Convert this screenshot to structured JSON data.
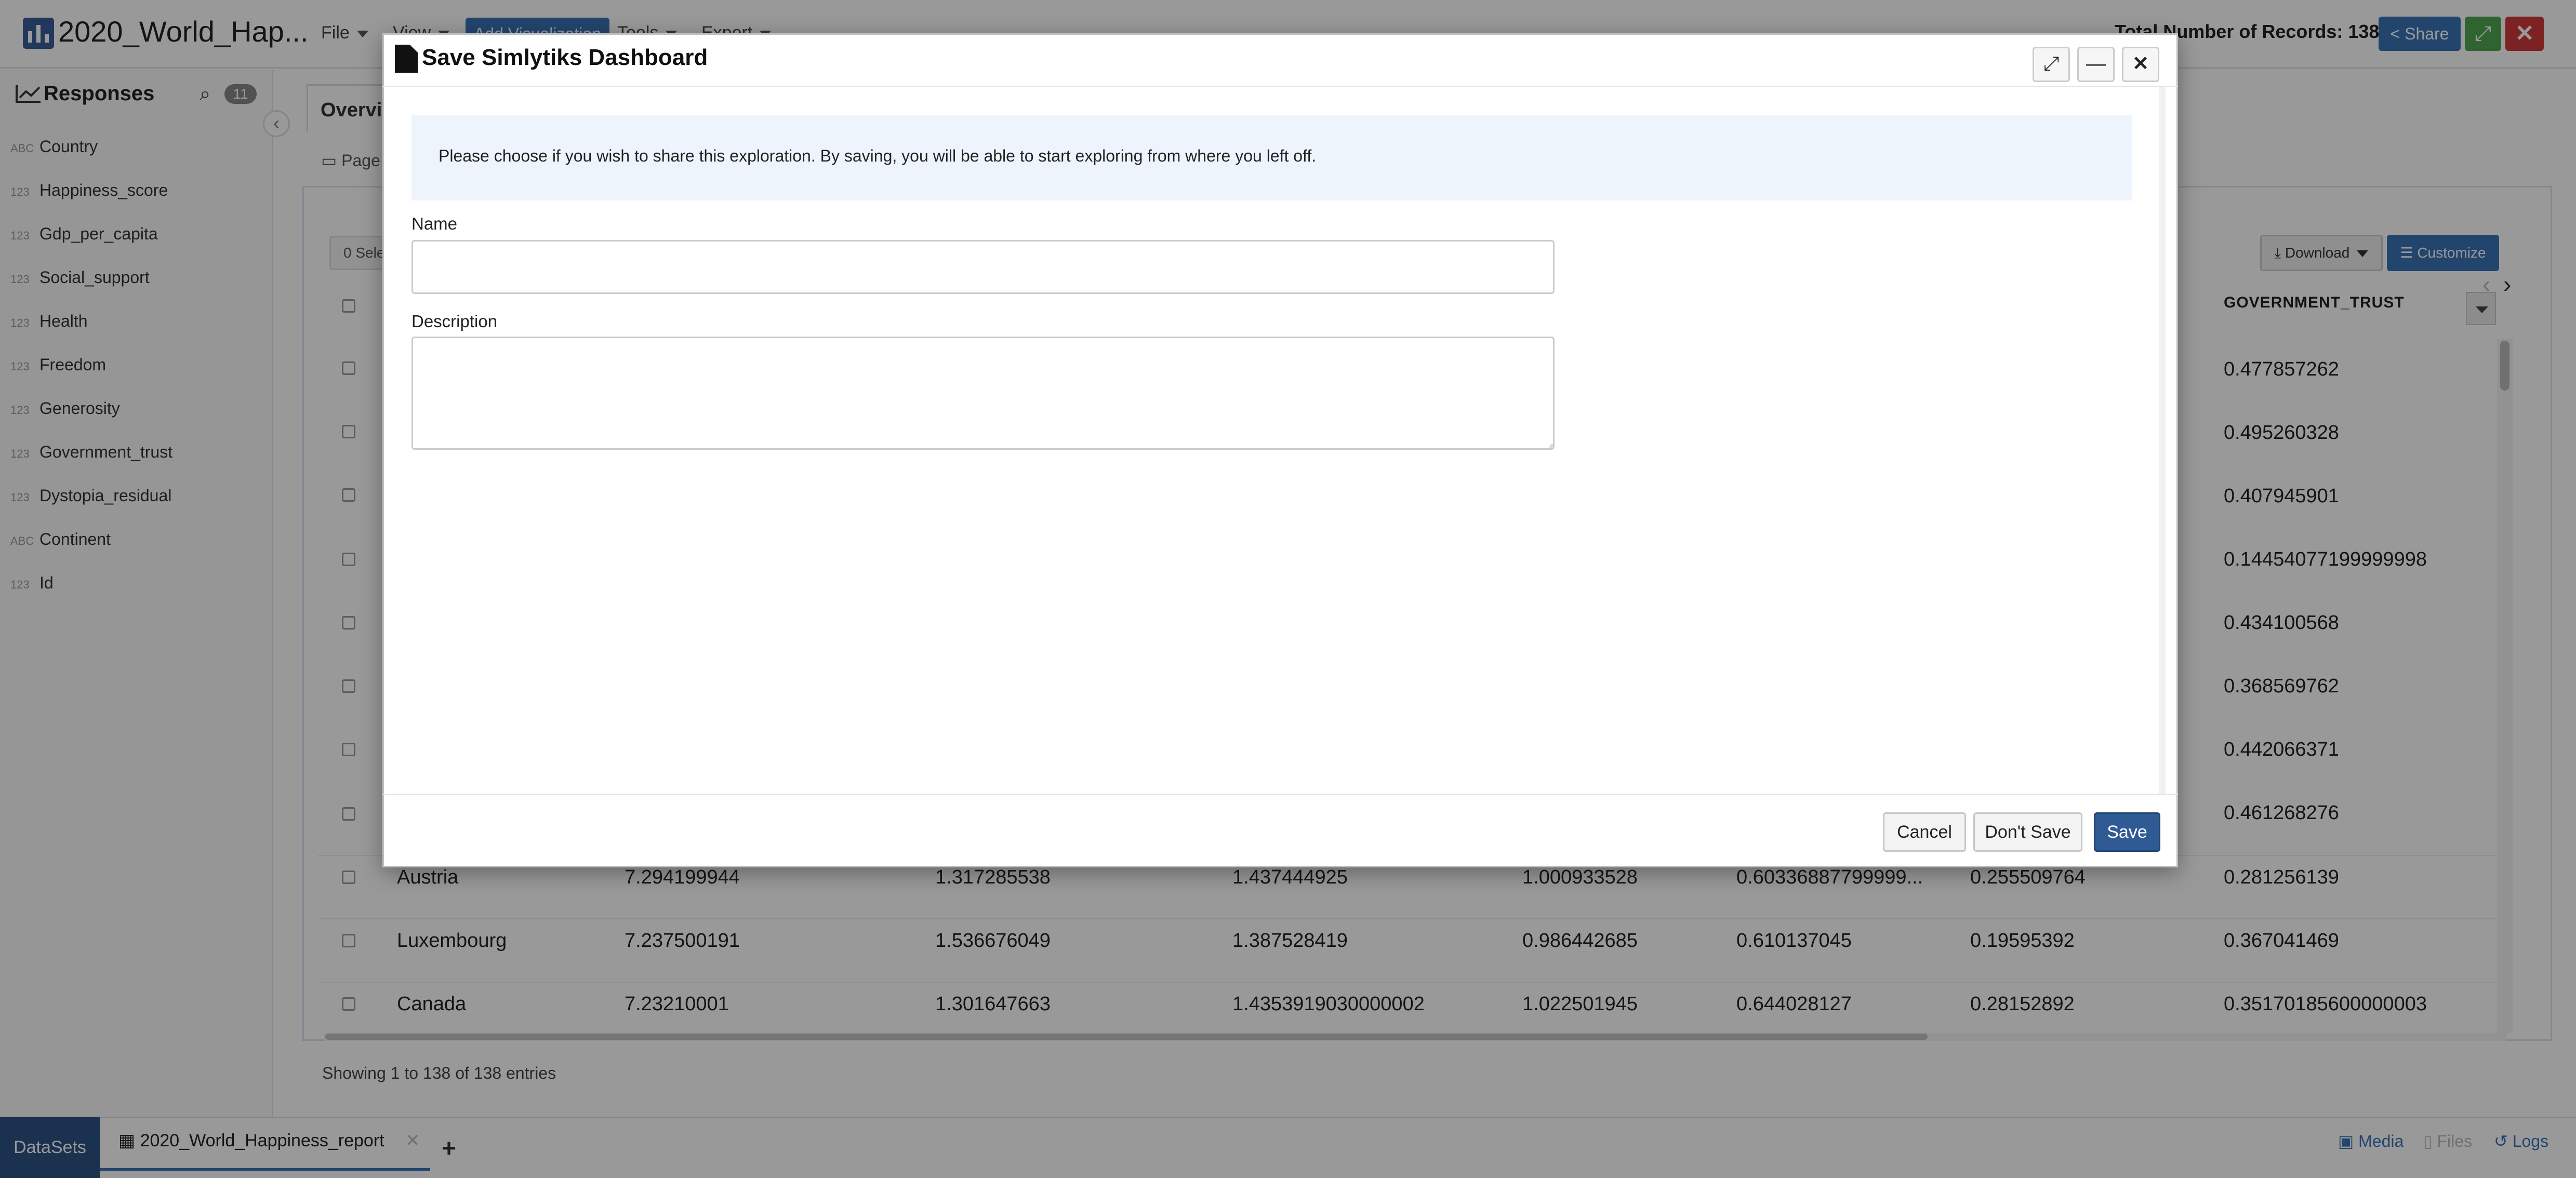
{
  "app": {
    "title": "2020_World_Hap...",
    "menus": [
      "File",
      "View",
      "Add Visualization",
      "Tools",
      "Export"
    ],
    "total_records": "Total Number of Records: 138",
    "share_label": "Share"
  },
  "sidebar": {
    "title": "Responses",
    "badge": "11",
    "fields": [
      {
        "type": "ABC",
        "name": "Country"
      },
      {
        "type": "123",
        "name": "Happiness_score"
      },
      {
        "type": "123",
        "name": "Gdp_per_capita"
      },
      {
        "type": "123",
        "name": "Social_support"
      },
      {
        "type": "123",
        "name": "Health"
      },
      {
        "type": "123",
        "name": "Freedom"
      },
      {
        "type": "123",
        "name": "Generosity"
      },
      {
        "type": "123",
        "name": "Government_trust"
      },
      {
        "type": "123",
        "name": "Dystopia_residual"
      },
      {
        "type": "ABC",
        "name": "Continent"
      },
      {
        "type": "123",
        "name": "Id"
      }
    ]
  },
  "main": {
    "tab_overview": "Overvie",
    "page_tab": "Page",
    "selected": "0 Sele",
    "download_label": "Download",
    "customize_label": "Customize",
    "column_header": "GOVERNMENT_TRUST",
    "gov_trust_column": [
      "0.477857262",
      "0.495260328",
      "0.407945901",
      "0.14454077199999998",
      "0.434100568",
      "0.368569762",
      "0.442066371",
      "0.461268276",
      "0.281256139",
      "0.367041469",
      "0.35170185600000003"
    ],
    "visible_rows": [
      [
        "Austria",
        "7.294199944",
        "1.317285538",
        "1.437444925",
        "1.000933528",
        "0.60336887799999...",
        "0.255509764"
      ],
      [
        "Luxembourg",
        "7.237500191",
        "1.536676049",
        "1.387528419",
        "0.986442685",
        "0.610137045",
        "0.19595392"
      ],
      [
        "Canada",
        "7.23210001",
        "1.301647663",
        "1.4353919030000002",
        "1.022501945",
        "0.644028127",
        "0.28152892"
      ]
    ],
    "showing": "Showing 1 to 138 of 138 entries"
  },
  "bottom": {
    "datasets": "DataSets",
    "tab": "2020_World_Happiness_report",
    "media": "Media",
    "files": "Files",
    "logs": "Logs"
  },
  "modal": {
    "title": "Save Simlytiks Dashboard",
    "info": "Please choose if you wish to share this exploration. By saving, you will be able to start exploring from where you left off.",
    "name_label": "Name",
    "name_value": "",
    "description_label": "Description",
    "description_value": "",
    "cancel": "Cancel",
    "dont_save": "Don't Save",
    "save": "Save"
  }
}
